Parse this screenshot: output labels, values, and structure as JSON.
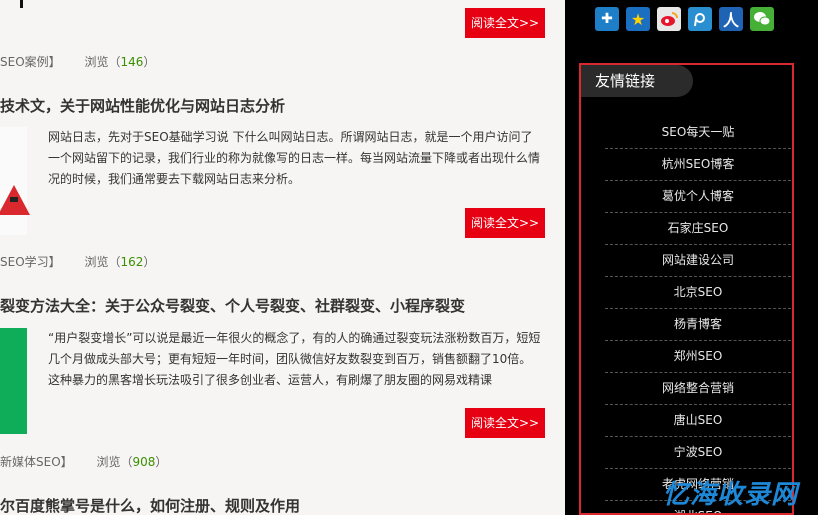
{
  "articles": [
    {
      "read_more": "阅读全文>>",
      "category": "SEO案例】",
      "views_label": "浏览（",
      "views": "146",
      "views_close": "）"
    },
    {
      "title": "技术文，关于网站性能优化与网站日志分析",
      "excerpt": "网站日志，先对于SEO基础学习说 下什么叫网站日志。所谓网站日志，就是一个用户访问了一个网站留下的记录，我们行业的称为就像写的日志一样。每当网站流量下降或者出现什么情况的时候，我们通常要去下载网站日志来分析。",
      "read_more": "阅读全文>>",
      "category": "SEO学习】",
      "views_label": "浏览（",
      "views": "162",
      "views_close": "）"
    },
    {
      "title": "裂变方法大全：关于公众号裂变、个人号裂变、社群裂变、小程序裂变",
      "excerpt": "“用户裂变增长”可以说是最近一年很火的概念了，有的人的确通过裂变玩法涨粉数百万，短短几个月做成头部大号；更有短短一年时间，团队微信好友数裂变到百万，销售额翻了10倍。这种暴力的黑客增长玩法吸引了很多创业者、运营人，有刷爆了朋友圈的网易戏精课",
      "read_more": "阅读全文>>",
      "category": "新媒体SEO】",
      "views_label": "浏览（",
      "views": "908",
      "views_close": "）"
    },
    {
      "title": "尔百度熊掌号是什么，如何注册、规则及作用"
    }
  ],
  "share_icons": [
    "add-icon",
    "qzone-star-icon",
    "weibo-icon",
    "tencent-weibo-icon",
    "renren-icon",
    "wechat-icon"
  ],
  "friend_links": {
    "heading": "友情链接",
    "items": [
      "SEO每天一贴",
      "杭州SEO博客",
      "葛优个人博客",
      "石家庄SEO",
      "网站建设公司",
      "北京SEO",
      "杨青博客",
      "郑州SEO",
      "网络整合营销",
      "唐山SEO",
      "宁波SEO",
      "老虎网络营销",
      "湖北SEO"
    ]
  },
  "watermark": "忆海收录网",
  "colors": {
    "accent": "#e60012",
    "views_number": "#3a8f00",
    "sidebar_bg": "#000000",
    "box_border": "#d9282e"
  }
}
